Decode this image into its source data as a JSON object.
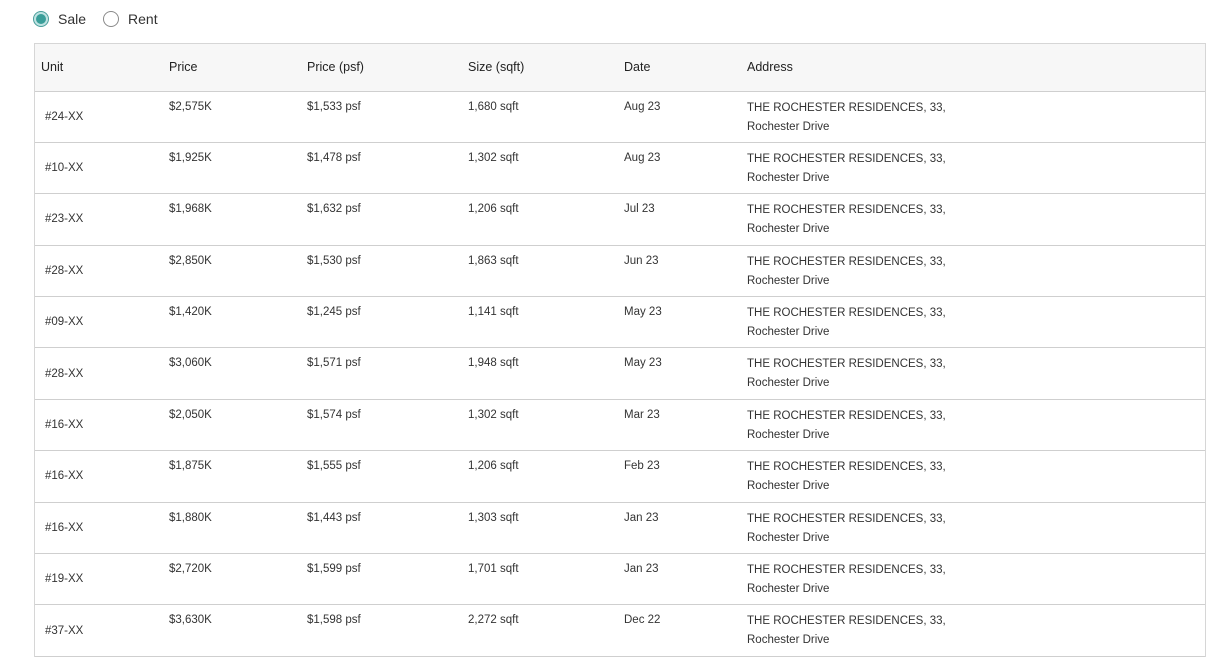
{
  "filter": {
    "options": [
      {
        "label": "Sale",
        "selected": true
      },
      {
        "label": "Rent",
        "selected": false
      }
    ]
  },
  "table": {
    "headers": [
      "Unit",
      "Price",
      "Price (psf)",
      "Size (sqft)",
      "Date",
      "Address"
    ],
    "rows": [
      {
        "unit": "#24-XX",
        "price": "$2,575K",
        "psf": "$1,533 psf",
        "size": "1,680 sqft",
        "date": "Aug 23",
        "address_line1": "THE ROCHESTER RESIDENCES, 33,",
        "address_line2": "Rochester Drive"
      },
      {
        "unit": "#10-XX",
        "price": "$1,925K",
        "psf": "$1,478 psf",
        "size": "1,302 sqft",
        "date": "Aug 23",
        "address_line1": "THE ROCHESTER RESIDENCES, 33,",
        "address_line2": "Rochester Drive"
      },
      {
        "unit": "#23-XX",
        "price": "$1,968K",
        "psf": "$1,632 psf",
        "size": "1,206 sqft",
        "date": "Jul 23",
        "address_line1": "THE ROCHESTER RESIDENCES, 33,",
        "address_line2": "Rochester Drive"
      },
      {
        "unit": "#28-XX",
        "price": "$2,850K",
        "psf": "$1,530 psf",
        "size": "1,863 sqft",
        "date": "Jun 23",
        "address_line1": "THE ROCHESTER RESIDENCES, 33,",
        "address_line2": "Rochester Drive"
      },
      {
        "unit": "#09-XX",
        "price": "$1,420K",
        "psf": "$1,245 psf",
        "size": "1,141 sqft",
        "date": "May 23",
        "address_line1": "THE ROCHESTER RESIDENCES, 33,",
        "address_line2": "Rochester Drive"
      },
      {
        "unit": "#28-XX",
        "price": "$3,060K",
        "psf": "$1,571 psf",
        "size": "1,948 sqft",
        "date": "May 23",
        "address_line1": "THE ROCHESTER RESIDENCES, 33,",
        "address_line2": "Rochester Drive"
      },
      {
        "unit": "#16-XX",
        "price": "$2,050K",
        "psf": "$1,574 psf",
        "size": "1,302 sqft",
        "date": "Mar 23",
        "address_line1": "THE ROCHESTER RESIDENCES, 33,",
        "address_line2": "Rochester Drive"
      },
      {
        "unit": "#16-XX",
        "price": "$1,875K",
        "psf": "$1,555 psf",
        "size": "1,206 sqft",
        "date": "Feb 23",
        "address_line1": "THE ROCHESTER RESIDENCES, 33,",
        "address_line2": "Rochester Drive"
      },
      {
        "unit": "#16-XX",
        "price": "$1,880K",
        "psf": "$1,443 psf",
        "size": "1,303 sqft",
        "date": "Jan 23",
        "address_line1": "THE ROCHESTER RESIDENCES, 33,",
        "address_line2": "Rochester Drive"
      },
      {
        "unit": "#19-XX",
        "price": "$2,720K",
        "psf": "$1,599 psf",
        "size": "1,701 sqft",
        "date": "Jan 23",
        "address_line1": "THE ROCHESTER RESIDENCES, 33,",
        "address_line2": "Rochester Drive"
      },
      {
        "unit": "#37-XX",
        "price": "$3,630K",
        "psf": "$1,598 psf",
        "size": "2,272 sqft",
        "date": "Dec 22",
        "address_line1": "THE ROCHESTER RESIDENCES, 33,",
        "address_line2": "Rochester Drive"
      }
    ]
  },
  "colors": {
    "accent": "#3a9e99",
    "accent_light": "#bfe3e2",
    "header_bg": "#f7f7f7",
    "border": "#cfcfcf"
  }
}
